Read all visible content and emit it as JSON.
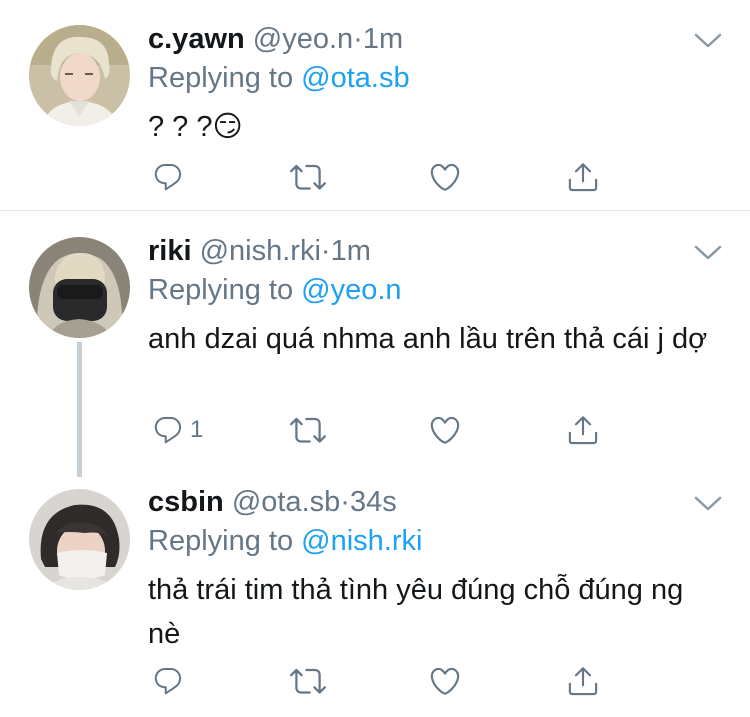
{
  "tweets": [
    {
      "display_name": "c.yawn",
      "handle": "@yeo.n",
      "separator": "·",
      "time": "1m",
      "replying_prefix": "Replying to",
      "replying_to": "@ota.sb",
      "text": "? ? ?😏",
      "reply_count": "",
      "icons": [
        "reply-icon",
        "retweet-icon",
        "like-icon",
        "share-icon"
      ]
    },
    {
      "display_name": "riki",
      "handle": "@nish.rki",
      "separator": "·",
      "time": "1m",
      "replying_prefix": "Replying to",
      "replying_to": "@yeo.n",
      "text": "anh dzai quá nhma anh lầu trên thả cái j dợ",
      "reply_count": "1",
      "icons": [
        "reply-icon",
        "retweet-icon",
        "like-icon",
        "share-icon"
      ]
    },
    {
      "display_name": "csbin",
      "handle": "@ota.sb",
      "separator": "·",
      "time": "34s",
      "replying_prefix": "Replying to",
      "replying_to": "@nish.rki",
      "text": "thả trái tim thả tình yêu đúng chỗ đúng ng nè",
      "reply_count": "",
      "icons": [
        "reply-icon",
        "retweet-icon",
        "like-icon",
        "share-icon"
      ]
    }
  ],
  "colors": {
    "text": "#14171a",
    "secondary": "#657786",
    "link": "#1da1f2",
    "thread_line": "#c4cfd6",
    "divider": "#e1e8ed"
  }
}
